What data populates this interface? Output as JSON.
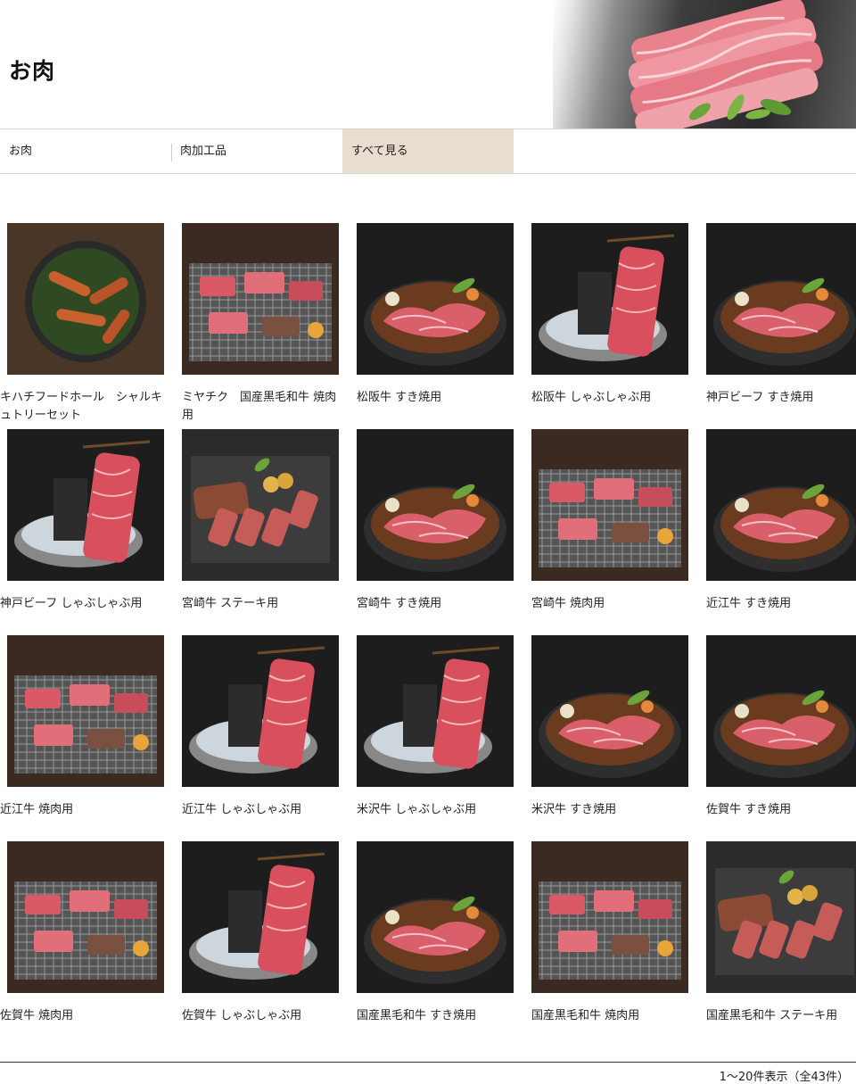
{
  "page": {
    "title": "お肉"
  },
  "tabs": [
    {
      "label": "お肉"
    },
    {
      "label": "肉加工品"
    },
    {
      "label": "すべて見る",
      "active": true
    }
  ],
  "products": [
    {
      "name": "キハチフードホール　シャルキュトリーセット",
      "kind": "sausage"
    },
    {
      "name": "ミヤチク　国産黒毛和牛 焼肉用",
      "kind": "yakiniku"
    },
    {
      "name": "松阪牛 すき焼用",
      "kind": "sukiyaki"
    },
    {
      "name": "松阪牛 しゃぶしゃぶ用",
      "kind": "shabu"
    },
    {
      "name": "神戸ビーフ すき焼用",
      "kind": "sukiyaki"
    },
    {
      "name": "神戸ビーフ しゃぶしゃぶ用",
      "kind": "shabu"
    },
    {
      "name": "宮崎牛 ステーキ用",
      "kind": "steak"
    },
    {
      "name": "宮崎牛 すき焼用",
      "kind": "sukiyaki"
    },
    {
      "name": "宮崎牛 焼肉用",
      "kind": "yakiniku"
    },
    {
      "name": "近江牛 すき焼用",
      "kind": "sukiyaki"
    },
    {
      "name": "近江牛 焼肉用",
      "kind": "yakiniku"
    },
    {
      "name": "近江牛 しゃぶしゃぶ用",
      "kind": "shabu"
    },
    {
      "name": "米沢牛 しゃぶしゃぶ用",
      "kind": "shabu"
    },
    {
      "name": "米沢牛 すき焼用",
      "kind": "sukiyaki"
    },
    {
      "name": "佐賀牛 すき焼用",
      "kind": "sukiyaki"
    },
    {
      "name": "佐賀牛 焼肉用",
      "kind": "yakiniku"
    },
    {
      "name": "佐賀牛 しゃぶしゃぶ用",
      "kind": "shabu"
    },
    {
      "name": "国産黒毛和牛 すき焼用",
      "kind": "sukiyaki"
    },
    {
      "name": "国産黒毛和牛 焼肉用",
      "kind": "yakiniku"
    },
    {
      "name": "国産黒毛和牛 ステーキ用",
      "kind": "steak"
    }
  ],
  "pagination": {
    "summary": "1～20件表示（全43件）"
  }
}
